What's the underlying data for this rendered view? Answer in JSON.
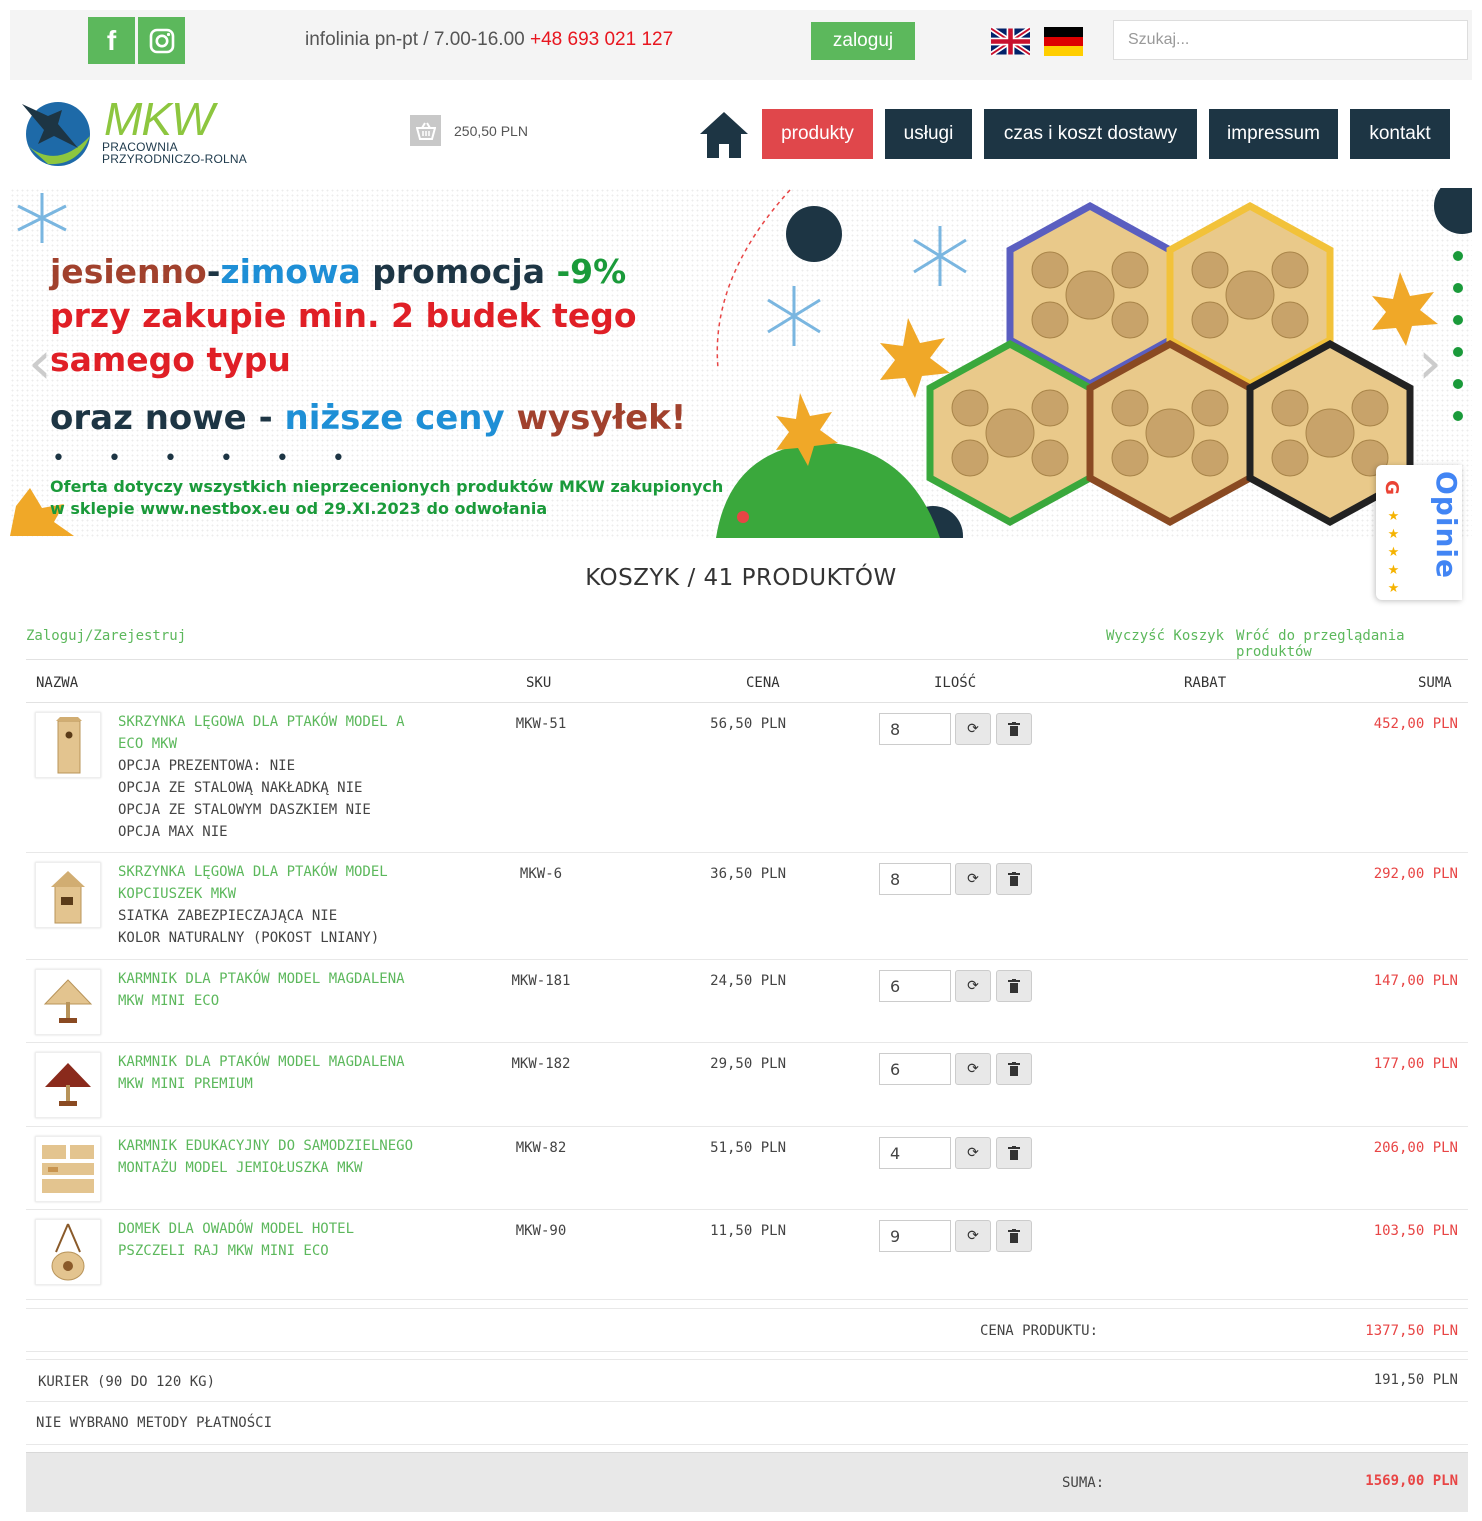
{
  "topbar": {
    "social": [
      {
        "name": "facebook-icon",
        "glyph": "f"
      },
      {
        "name": "instagram-icon",
        "glyph": ""
      }
    ],
    "infoline_text": "infolinia pn-pt / 7.00-16.00 ",
    "infoline_phone": "+48 693 021 127",
    "login_label": "zaloguj",
    "search_placeholder": "Szukaj..."
  },
  "header": {
    "logo_text": "MKW",
    "logo_subtitle_1": "PRACOWNIA",
    "logo_subtitle_2": "PRZYRODNICZO-ROLNA",
    "cart_total": "250,50 PLN",
    "nav": [
      "produkty",
      "usługi",
      "czas i koszt dostawy",
      "impressum",
      "kontakt"
    ]
  },
  "banner": {
    "line1_a": "jesienno",
    "line1_b": "-",
    "line1_c": "zimowa",
    "line1_d": " promocja ",
    "line1_e": "-9%",
    "line2": "przy zakupie min. 2  budek tego",
    "line3": "samego typu",
    "line4_a": "oraz nowe - ",
    "line4_b": "niższe ceny",
    "line4_c": " wysyłek!",
    "bullets": "• • • • • •",
    "note_1": "Oferta dotyczy wszystkich nieprzecenionych produktów MKW zakupionych",
    "note_2": "w sklepie www.nestbox.eu od 29.XI.2023 do odwołania",
    "opinie": "Opinie"
  },
  "cart": {
    "title": "KOSZYK / 41 PRODUKTÓW",
    "login_link": "Zaloguj/Zarejestruj",
    "clear_link": "Wyczyść Koszyk",
    "back_link": "Wróć do przeglądania produktów",
    "columns": {
      "name": "NAZWA",
      "sku": "SKU",
      "price": "CENA",
      "qty": "ILOŚĆ",
      "discount": "RABAT",
      "sum": "SUMA"
    },
    "items": [
      {
        "title_1": "SKRZYNKA LĘGOWA DLA PTAKÓW MODEL A",
        "title_2": "ECO MKW",
        "options": [
          "OPCJA PREZENTOWA: NIE",
          "OPCJA ZE STALOWĄ NAKŁADKĄ NIE",
          "OPCJA ZE STALOWYM DASZKIEM NIE",
          "OPCJA MAX NIE"
        ],
        "sku": "MKW-51",
        "price": "56,50 PLN",
        "qty": "8",
        "sum": "452,00 PLN"
      },
      {
        "title_1": "SKRZYNKA LĘGOWA DLA PTAKÓW MODEL",
        "title_2": "KOPCIUSZEK MKW",
        "options": [
          "SIATKA ZABEZPIECZAJĄCA NIE",
          "KOLOR NATURALNY (POKOST LNIANY)"
        ],
        "sku": "MKW-6",
        "price": "36,50 PLN",
        "qty": "8",
        "sum": "292,00 PLN"
      },
      {
        "title_1": "KARMNIK DLA PTAKÓW MODEL MAGDALENA",
        "title_2": "MKW MINI ECO",
        "options": [],
        "sku": "MKW-181",
        "price": "24,50 PLN",
        "qty": "6",
        "sum": "147,00 PLN"
      },
      {
        "title_1": "KARMNIK DLA PTAKÓW MODEL MAGDALENA",
        "title_2": "MKW MINI PREMIUM",
        "options": [],
        "sku": "MKW-182",
        "price": "29,50 PLN",
        "qty": "6",
        "sum": "177,00 PLN"
      },
      {
        "title_1": "KARMNIK EDUKACYJNY DO SAMODZIELNEGO",
        "title_2": "MONTAŻU MODEL JEMIOŁUSZKA MKW",
        "options": [],
        "sku": "MKW-82",
        "price": "51,50 PLN",
        "qty": "4",
        "sum": "206,00 PLN"
      },
      {
        "title_1": "DOMEK DLA OWADÓW MODEL HOTEL",
        "title_2": "PSZCZELI RAJ MKW MINI ECO",
        "options": [],
        "sku": "MKW-90",
        "price": "11,50 PLN",
        "qty": "9",
        "sum": "103,50 PLN"
      }
    ],
    "product_price_label": "CENA PRODUKTU:",
    "product_price": "1377,50 PLN",
    "shipping_label": "KURIER (90 DO 120 KG)",
    "shipping_price": "191,50 PLN",
    "payment_label": "NIE WYBRANO METODY PŁATNOŚCI",
    "total_label": "SUMA:",
    "total": "1569,00 PLN"
  },
  "colors": {
    "accent_green": "#5cb85c",
    "nav_dark": "#1d3544",
    "nav_active": "#e0474b",
    "price_red": "#e84545"
  }
}
